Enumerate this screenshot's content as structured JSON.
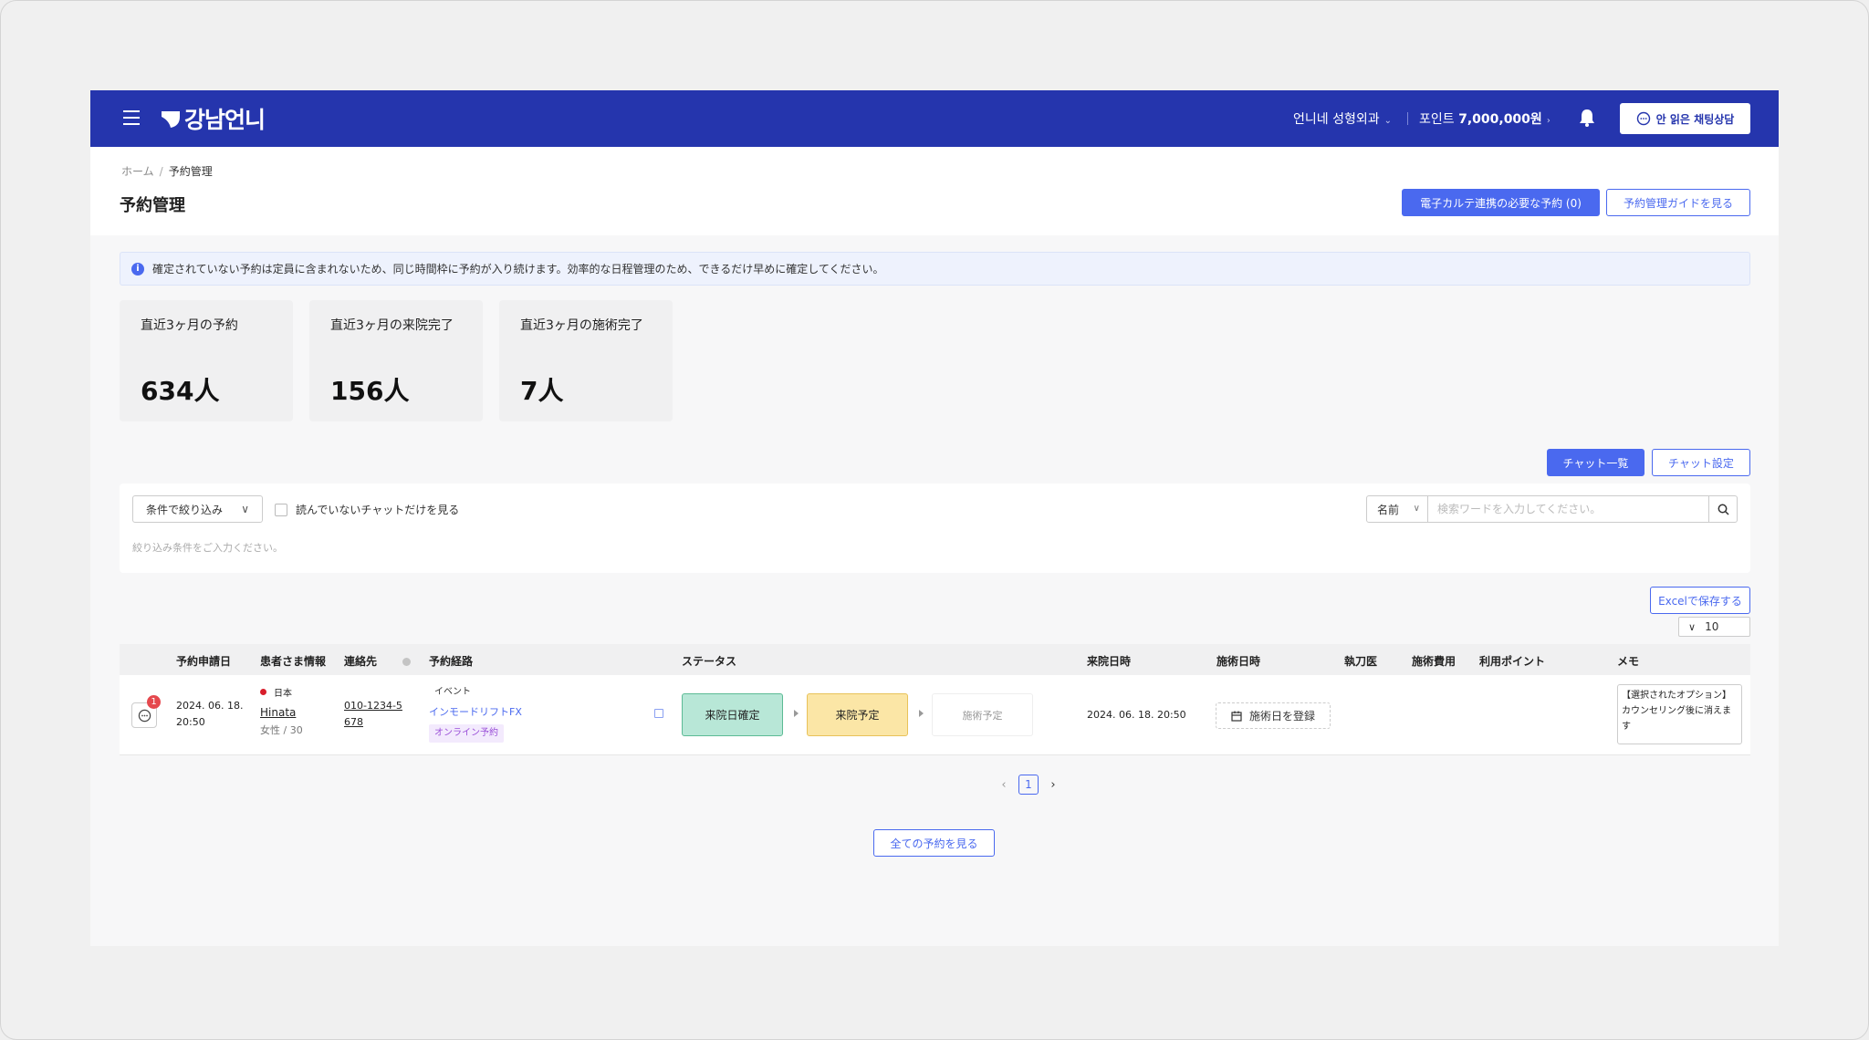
{
  "header": {
    "logo_text": "강남언니",
    "hospital_name": "언니네 성형외과",
    "points_label": "포인트",
    "points_value": "7,000,000원",
    "chat_button": "안 읽은 채팅상담"
  },
  "breadcrumb": {
    "home": "ホーム",
    "separator": "/",
    "current": "予約管理"
  },
  "page": {
    "title": "予約管理",
    "emr_button": "電子カルテ連携の必要な予約 (0)",
    "guide_button": "予約管理ガイドを見る"
  },
  "info_banner": {
    "icon": "i",
    "text": "確定されていない予約は定員に含まれないため、同じ時間枠に予約が入り続けます。効率的な日程管理のため、できるだけ早めに確定してください。"
  },
  "stats": [
    {
      "label": "直近3ヶ月の予約",
      "value": "634人"
    },
    {
      "label": "直近3ヶ月の来院完了",
      "value": "156人"
    },
    {
      "label": "直近3ヶ月の施術完了",
      "value": "7人"
    }
  ],
  "chat_controls": {
    "chat_list": "チャット一覧",
    "chat_settings": "チャット設定"
  },
  "filter": {
    "select_label": "条件で絞り込み",
    "unread_only": "読んでいないチャットだけを見る",
    "hint": "絞り込み条件をご入力ください。",
    "search_type": "名前",
    "search_placeholder": "検索ワードを入力してください。"
  },
  "excel_button": "Excelで保存する",
  "page_size": "10",
  "table": {
    "headers": {
      "applied": "予約申請日",
      "patient": "患者さま情報",
      "contact": "連絡先",
      "route": "予約経路",
      "status": "ステータス",
      "visit_date": "来院日時",
      "treat_date": "施術日時",
      "doctor": "執刀医",
      "fee": "施術費用",
      "points": "利用ポイント",
      "memo": "メモ"
    },
    "rows": [
      {
        "unread": "1",
        "applied_date": "2024. 06. 18.",
        "applied_time": "20:50",
        "country": "日本",
        "name": "Hinata",
        "gender_age": "女性 / 30",
        "phone_1": "010-1234-5",
        "phone_2": "678",
        "route_type": "イベント",
        "route_name": "インモードリフトFX",
        "route_badge": "オンライン予約",
        "status_1": "来院日確定",
        "status_2": "来院予定",
        "status_3": "施術予定",
        "visit_datetime": "2024. 06. 18. 20:50",
        "treat_register": "施術日を登録",
        "memo": "【選択されたオプション】カウンセリング後に消えます"
      }
    ]
  },
  "pagination": {
    "prev": "‹",
    "current": "1",
    "next": "›"
  },
  "view_all": "全ての予約を見る",
  "colors": {
    "header_bg": "#2535ad",
    "accent": "#4a69ef",
    "status_confirmed": "#b8e7d7",
    "status_planned": "#fbe6a6"
  }
}
